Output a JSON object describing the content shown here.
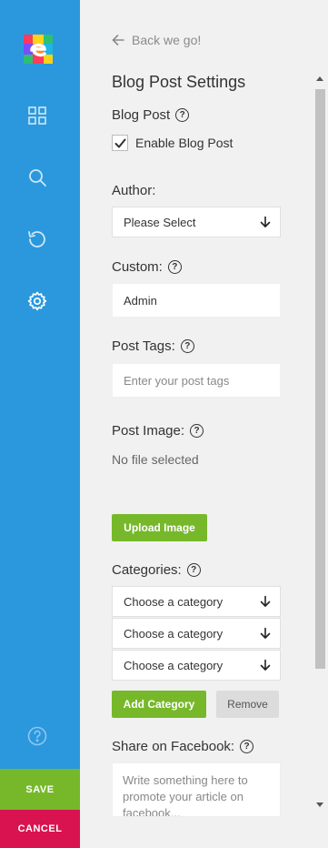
{
  "sidebar": {
    "logo_icon": "logo-e-icon",
    "icons": [
      "dashboard-grid-icon",
      "search-icon",
      "history-icon",
      "gear-icon",
      "help-icon"
    ],
    "save_label": "SAVE",
    "cancel_label": "CANCEL",
    "colors": {
      "rail": "#2b98dd",
      "save": "#77b82a",
      "cancel": "#d8134f"
    }
  },
  "panel": {
    "back_label": "Back we go!",
    "title": "Blog Post Settings",
    "blog_post": {
      "label": "Blog Post",
      "checkbox_label": "Enable Blog Post",
      "checked": true
    },
    "author": {
      "label": "Author:",
      "value": "Please Select"
    },
    "custom": {
      "label": "Custom:",
      "value": "Admin"
    },
    "post_tags": {
      "label": "Post Tags:",
      "placeholder": "Enter your post tags"
    },
    "post_image": {
      "label": "Post Image:",
      "status": "No file selected",
      "upload_label": "Upload Image"
    },
    "categories": {
      "label": "Categories:",
      "selects": [
        "Choose a category",
        "Choose a category",
        "Choose a category"
      ],
      "add_label": "Add Category",
      "remove_label": "Remove"
    },
    "facebook": {
      "label": "Share on Facebook:",
      "placeholder": "Write something here to promote your article on facebook..."
    }
  }
}
